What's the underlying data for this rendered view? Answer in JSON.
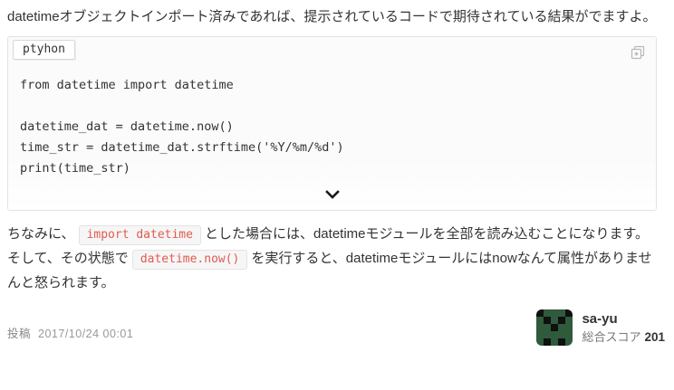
{
  "answer": {
    "paragraph_lead": "datetimeオブジェクトインポート済みであれば、提示されているコードで期待されている結果がでますよ。",
    "code_block": {
      "language_label": "ptyhon",
      "code": "from datetime import datetime\n\ndatetime_dat = datetime.now()\ntime_str = datetime_dat.strftime('%Y/%m/%d')\nprint(time_str)"
    },
    "paragraph_note1": {
      "before": "ちなみに、",
      "code": "import datetime",
      "after": "とした場合には、datetimeモジュールを全部を読み込むことになります。"
    },
    "paragraph_note2": {
      "before": "そして、その状態で",
      "code": "datetime.now()",
      "after": "を実行すると、datetimeモジュールにはnowなんて属性がありませんと怒られます。"
    }
  },
  "footer": {
    "posted_label": "投稿",
    "posted_datetime": "2017/10/24 00:01",
    "user": {
      "username": "sa-yu",
      "score_label": "総合スコア",
      "score_value": "201"
    }
  },
  "icons": {
    "copy": "copy-icon",
    "expand": "chevron-down-icon"
  },
  "colors": {
    "inline_code_text": "#e25a50",
    "code_block_border": "#e3e3e3",
    "avatar_green": "#2f5a3c",
    "avatar_black": "#101010",
    "muted_text": "#999999"
  },
  "avatar": {
    "pattern": [
      [
        1,
        0,
        0,
        0,
        1
      ],
      [
        0,
        1,
        0,
        1,
        0
      ],
      [
        0,
        0,
        1,
        0,
        0
      ],
      [
        0,
        0,
        0,
        0,
        0
      ],
      [
        0,
        1,
        0,
        1,
        0
      ]
    ]
  }
}
